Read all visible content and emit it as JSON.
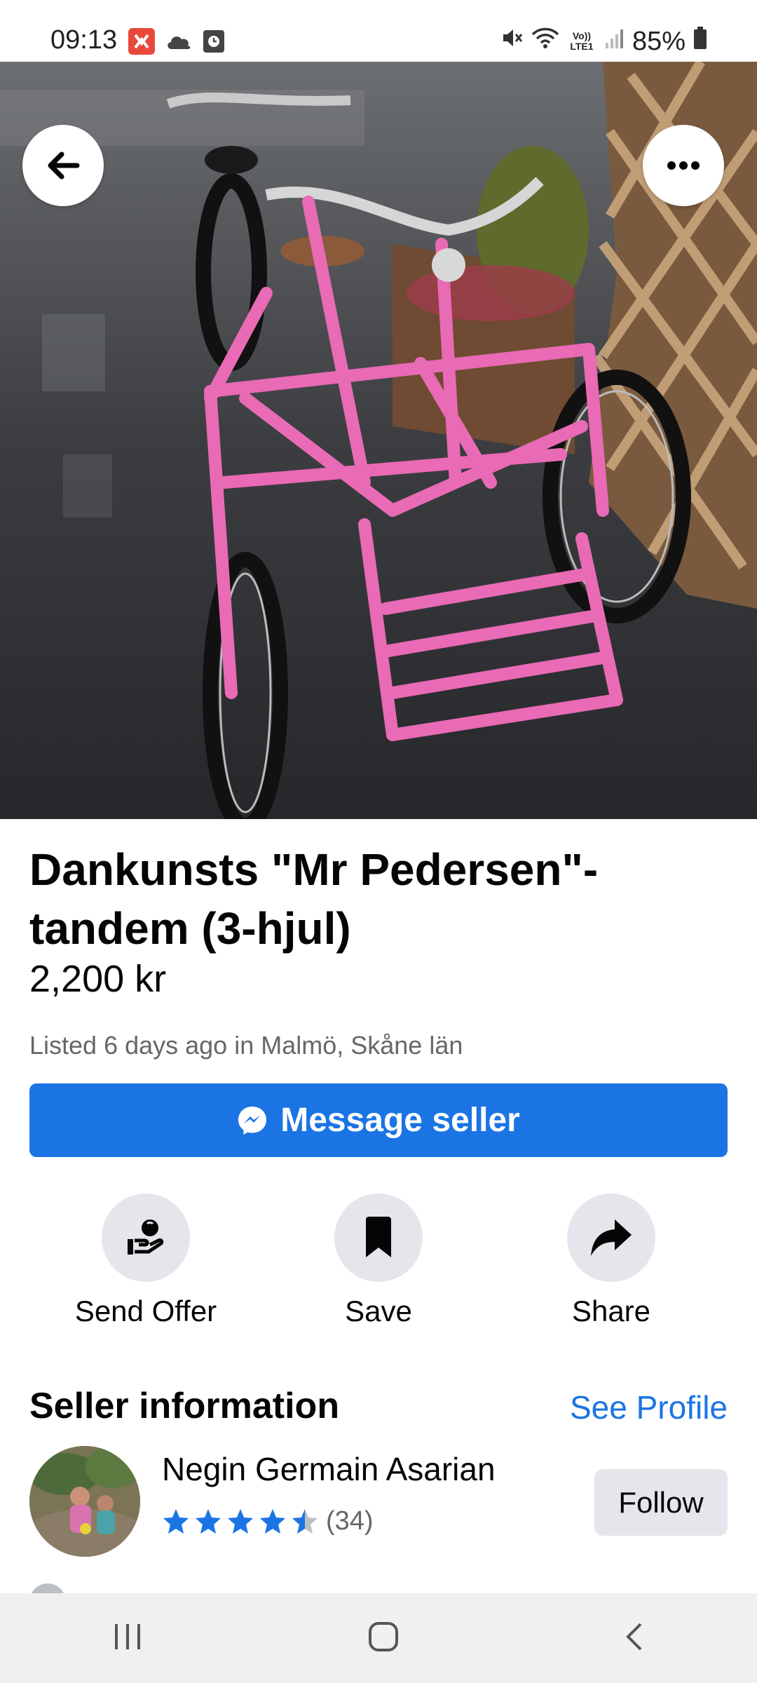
{
  "status_bar": {
    "time": "09:13",
    "battery": "85%",
    "network_label": "Vo)) LTE1",
    "icons": [
      "app-notification-icon",
      "cloud-icon",
      "alarm-icon",
      "mute-icon",
      "wifi-icon",
      "signal-icon",
      "battery-icon"
    ]
  },
  "hero": {
    "image_count": 5,
    "active_index": 2
  },
  "listing": {
    "title": "Dankunsts \"Mr Pedersen\"-tandem (3-hjul)",
    "price": "2,200 kr",
    "listed": "Listed 6 days ago in Malmö, Skåne län",
    "message_label": "Message seller"
  },
  "actions": [
    {
      "label": "Send Offer",
      "icon": "send-offer-icon"
    },
    {
      "label": "Save",
      "icon": "bookmark-icon"
    },
    {
      "label": "Share",
      "icon": "share-arrow-icon"
    }
  ],
  "seller": {
    "heading": "Seller information",
    "see_profile": "See Profile",
    "name": "Negin Germain Asarian",
    "rating": 4.5,
    "rating_count": "(34)",
    "follow_label": "Follow"
  },
  "colors": {
    "accent": "#1b74e4",
    "star": "#1b74e4",
    "secondary_text": "#65676b",
    "button_bg": "#e4e6eb",
    "bike_pink": "#e96ab5"
  },
  "nav": {
    "icons": [
      "recent-apps-icon",
      "home-icon",
      "back-icon"
    ]
  }
}
